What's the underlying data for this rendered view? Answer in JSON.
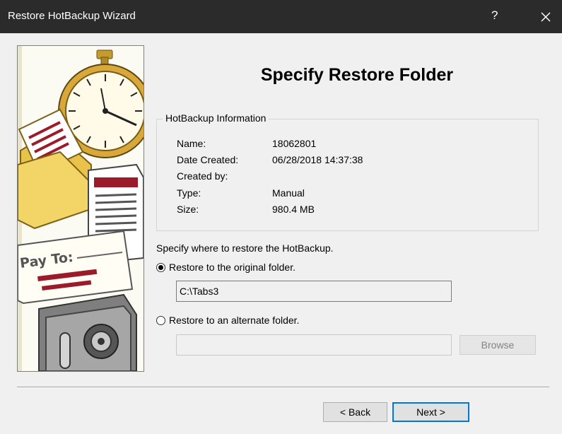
{
  "window": {
    "title": "Restore HotBackup Wizard",
    "help_glyph": "?"
  },
  "illustration": {
    "payto_text": "Pay To:"
  },
  "page": {
    "heading": "Specify Restore Folder"
  },
  "info": {
    "legend": "HotBackup Information",
    "rows": [
      {
        "label": "Name:",
        "value": "18062801"
      },
      {
        "label": "Date Created:",
        "value": "06/28/2018 14:37:38"
      },
      {
        "label": "Created by:",
        "value": ""
      },
      {
        "label": "Type:",
        "value": "Manual"
      },
      {
        "label": "Size:",
        "value": "980.4 MB"
      }
    ]
  },
  "restore": {
    "prompt": "Specify where to restore the HotBackup.",
    "original": {
      "label": "Restore to the original folder.",
      "selected": true,
      "path": "C:\\Tabs3"
    },
    "alternate": {
      "label": "Restore to an alternate folder.",
      "selected": false,
      "path": ""
    },
    "browse_label": "Browse"
  },
  "footer": {
    "back_label": "< Back",
    "next_label": "Next >"
  }
}
